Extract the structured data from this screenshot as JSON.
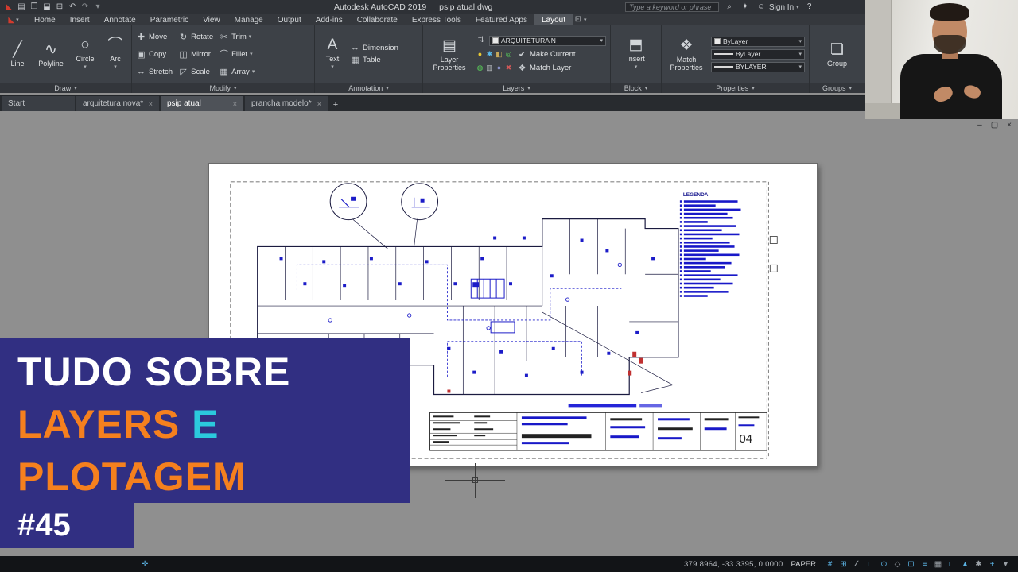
{
  "titlebar": {
    "app_title": "Autodesk AutoCAD 2019",
    "doc_title": "psip atual.dwg",
    "search_placeholder": "Type a keyword or phrase",
    "sign_in_label": "Sign In",
    "icons": {
      "search": "⌕",
      "keytip": "✦",
      "avatar": "☺",
      "caret": "▾",
      "help": "?"
    },
    "qat_icons": [
      {
        "name": "autocad-logo-icon",
        "glyph": "◣",
        "color": "#d23b2e"
      },
      {
        "name": "new-file-icon",
        "glyph": "▤",
        "color": "#c9ccd0"
      },
      {
        "name": "open-file-icon",
        "glyph": "❒",
        "color": "#c9ccd0"
      },
      {
        "name": "save-icon",
        "glyph": "⬓",
        "color": "#c9ccd0"
      },
      {
        "name": "plot-icon",
        "glyph": "⊟",
        "color": "#c9ccd0"
      },
      {
        "name": "undo-icon",
        "glyph": "↶",
        "color": "#c9ccd0"
      },
      {
        "name": "redo-icon",
        "glyph": "↷",
        "color": "#8c9094"
      },
      {
        "name": "qat-dropdown-icon",
        "glyph": "▾",
        "color": "#8c9094"
      }
    ]
  },
  "ribbon_tabs": {
    "tabs": [
      "Home",
      "Insert",
      "Annotate",
      "Parametric",
      "View",
      "Manage",
      "Output",
      "Add-ins",
      "Collaborate",
      "Express Tools",
      "Featured Apps",
      "Layout"
    ],
    "active_tab": "Layout"
  },
  "ribbon": {
    "icon_glyphs": {
      "line": "╱",
      "polyline": "∿",
      "circle": "○",
      "arc": "⌒",
      "move": "✚",
      "rotate": "↻",
      "trim": "✂",
      "copy": "▣",
      "mirror": "◫",
      "fillet": "⌒",
      "stretch": "↔",
      "scale": "◸",
      "array": "▦",
      "text": "A",
      "dimension": "↔",
      "table": "▦",
      "layer_properties": "▤",
      "layer_state": "⇅",
      "make_current": "✔",
      "match_layer": "❖",
      "insert": "⬒",
      "match_properties": "❖",
      "group": "❏"
    },
    "draw": {
      "label": "Draw",
      "line": "Line",
      "polyline": "Polyline",
      "circle": "Circle",
      "arc": "Arc"
    },
    "modify": {
      "label": "Modify",
      "move": "Move",
      "rotate": "Rotate",
      "trim": "Trim",
      "copy": "Copy",
      "mirror": "Mirror",
      "fillet": "Fillet",
      "stretch": "Stretch",
      "scale": "Scale",
      "array": "Array"
    },
    "annotation": {
      "label": "Annotation",
      "text": "Text",
      "dimension": "Dimension",
      "table": "Table"
    },
    "layers": {
      "label": "Layers",
      "layer_properties": "Layer Properties",
      "current_layer": "ARQUITETURA N",
      "make_current": "Make Current",
      "match_layer": "Match Layer",
      "row1_icons": [
        {
          "name": "layer-on-icon",
          "glyph": "●",
          "color": "#e8c832"
        },
        {
          "name": "layer-freeze-icon",
          "glyph": "✱",
          "color": "#58b8e8"
        },
        {
          "name": "layer-lock-icon",
          "glyph": "◧",
          "color": "#c8a858"
        },
        {
          "name": "layer-isolate-icon",
          "glyph": "◎",
          "color": "#58c858"
        }
      ],
      "row2_icons": [
        {
          "name": "layer-unisolate-icon",
          "glyph": "◍",
          "color": "#58c858"
        },
        {
          "name": "layer-walk-icon",
          "glyph": "▥",
          "color": "#c0c4c8"
        },
        {
          "name": "layer-off-icon",
          "glyph": "●",
          "color": "#8890c8"
        },
        {
          "name": "layer-delete-icon",
          "glyph": "✖",
          "color": "#d05858"
        }
      ]
    },
    "block": {
      "label": "Block",
      "insert": "Insert"
    },
    "properties": {
      "label": "Properties",
      "match_properties": "Match Properties",
      "color": "ByLayer",
      "lineweight": "ByLayer",
      "linetype": "BYLAYER"
    },
    "groups": {
      "label": "Groups",
      "group": "Group"
    }
  },
  "doc_tabs": {
    "start": "Start",
    "tab1": "arquitetura nova*",
    "tab2": "psip atual",
    "tab3": "prancha modelo*",
    "new_tab": "+",
    "close_glyph": "×"
  },
  "window_controls": {
    "minimize": "–",
    "restore": "▢",
    "close": "×"
  },
  "drawing": {
    "legend_title": "LEGENDA",
    "sheet_number": "04",
    "legend_bar_widths": [
      68,
      40,
      72,
      55,
      62,
      30,
      66,
      48,
      70,
      36,
      58,
      64,
      44,
      70,
      28,
      60,
      52,
      34,
      68,
      46,
      62,
      38,
      56,
      30
    ]
  },
  "statusbar": {
    "coords": "379.8964, -33.3395, 0.0000",
    "space_label": "PAPER",
    "left_icon": "✛",
    "icons": [
      {
        "name": "grid-icon",
        "glyph": "#",
        "color": "#5ab0e0"
      },
      {
        "name": "snap-icon",
        "glyph": "⊞",
        "color": "#5ab0e0"
      },
      {
        "name": "infer-constraints-icon",
        "glyph": "∠",
        "color": "#9aa0a6"
      },
      {
        "name": "ortho-icon",
        "glyph": "∟",
        "color": "#5ab0e0"
      },
      {
        "name": "polar-tracking-icon",
        "glyph": "⊙",
        "color": "#5ab0e0"
      },
      {
        "name": "isodraft-icon",
        "glyph": "◇",
        "color": "#9aa0a6"
      },
      {
        "name": "object-snap-icon",
        "glyph": "⊡",
        "color": "#5ab0e0"
      },
      {
        "name": "lineweight-display-icon",
        "glyph": "≡",
        "color": "#5ab0e0"
      },
      {
        "name": "transparency-icon",
        "glyph": "▦",
        "color": "#9aa0a6"
      },
      {
        "name": "selection-cycling-icon",
        "glyph": "□",
        "color": "#5ab0e0"
      },
      {
        "name": "annotation-scale-icon",
        "glyph": "▲",
        "color": "#5ab0e0"
      },
      {
        "name": "workspace-switch-icon",
        "glyph": "✱",
        "color": "#9aa0a6"
      },
      {
        "name": "annotation-monitor-icon",
        "glyph": "+",
        "color": "#5ab0e0"
      },
      {
        "name": "customize-icon",
        "glyph": "▾",
        "color": "#9aa0a6"
      }
    ]
  },
  "overlay": {
    "line1": "TUDO SOBRE",
    "line2_a": "LAYERS ",
    "line2_b": "E",
    "line3": "PLOTAGEM",
    "badge": "#45",
    "bg": "#312f82",
    "accent_orange": "#f5801e",
    "accent_cyan": "#2bc9dd"
  }
}
